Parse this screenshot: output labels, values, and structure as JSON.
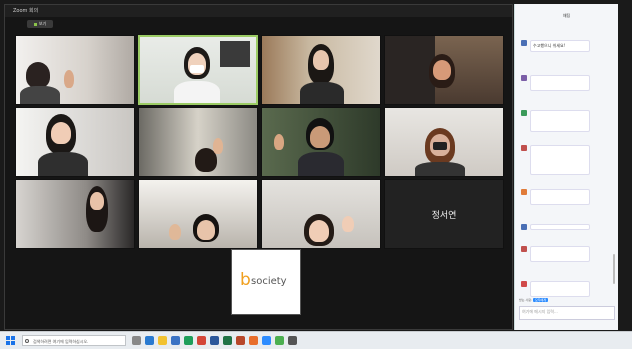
{
  "window": {
    "title": "Zoom 회의"
  },
  "view_pill": {
    "label": "보기"
  },
  "tiles": [
    {
      "name": ""
    },
    {
      "name": ""
    },
    {
      "name": ""
    },
    {
      "name": ""
    },
    {
      "name": ""
    },
    {
      "name": ""
    },
    {
      "name": ""
    },
    {
      "name": ""
    },
    {
      "name": ""
    },
    {
      "name": ""
    },
    {
      "name": ""
    },
    {
      "name": ""
    }
  ],
  "blank_tile": {
    "display_name": "정서연"
  },
  "logo": {
    "b": "b",
    "rest": "society"
  },
  "chat": {
    "title": "채팅",
    "messages": [
      {
        "meta": "",
        "text": "수고했으니 쉬세요!"
      },
      {
        "meta": "",
        "text": ""
      },
      {
        "meta": "",
        "text": ""
      },
      {
        "meta": "",
        "text": ""
      },
      {
        "meta": "",
        "text": ""
      },
      {
        "meta": "",
        "text": ""
      },
      {
        "meta": "",
        "text": ""
      },
      {
        "meta": "",
        "text": ""
      }
    ],
    "to_label": "받는 사람:",
    "to_target": "모두에게",
    "input_placeholder": "여기에 메시지 입력..."
  },
  "taskbar": {
    "search_placeholder": "검색하려면 여기에 입력하십시오.",
    "weather": "",
    "time": "",
    "date": ""
  },
  "colors": {
    "accent": "#2d8cff",
    "active_speaker": "#9ccc65",
    "logo_b": "#f0a020"
  }
}
